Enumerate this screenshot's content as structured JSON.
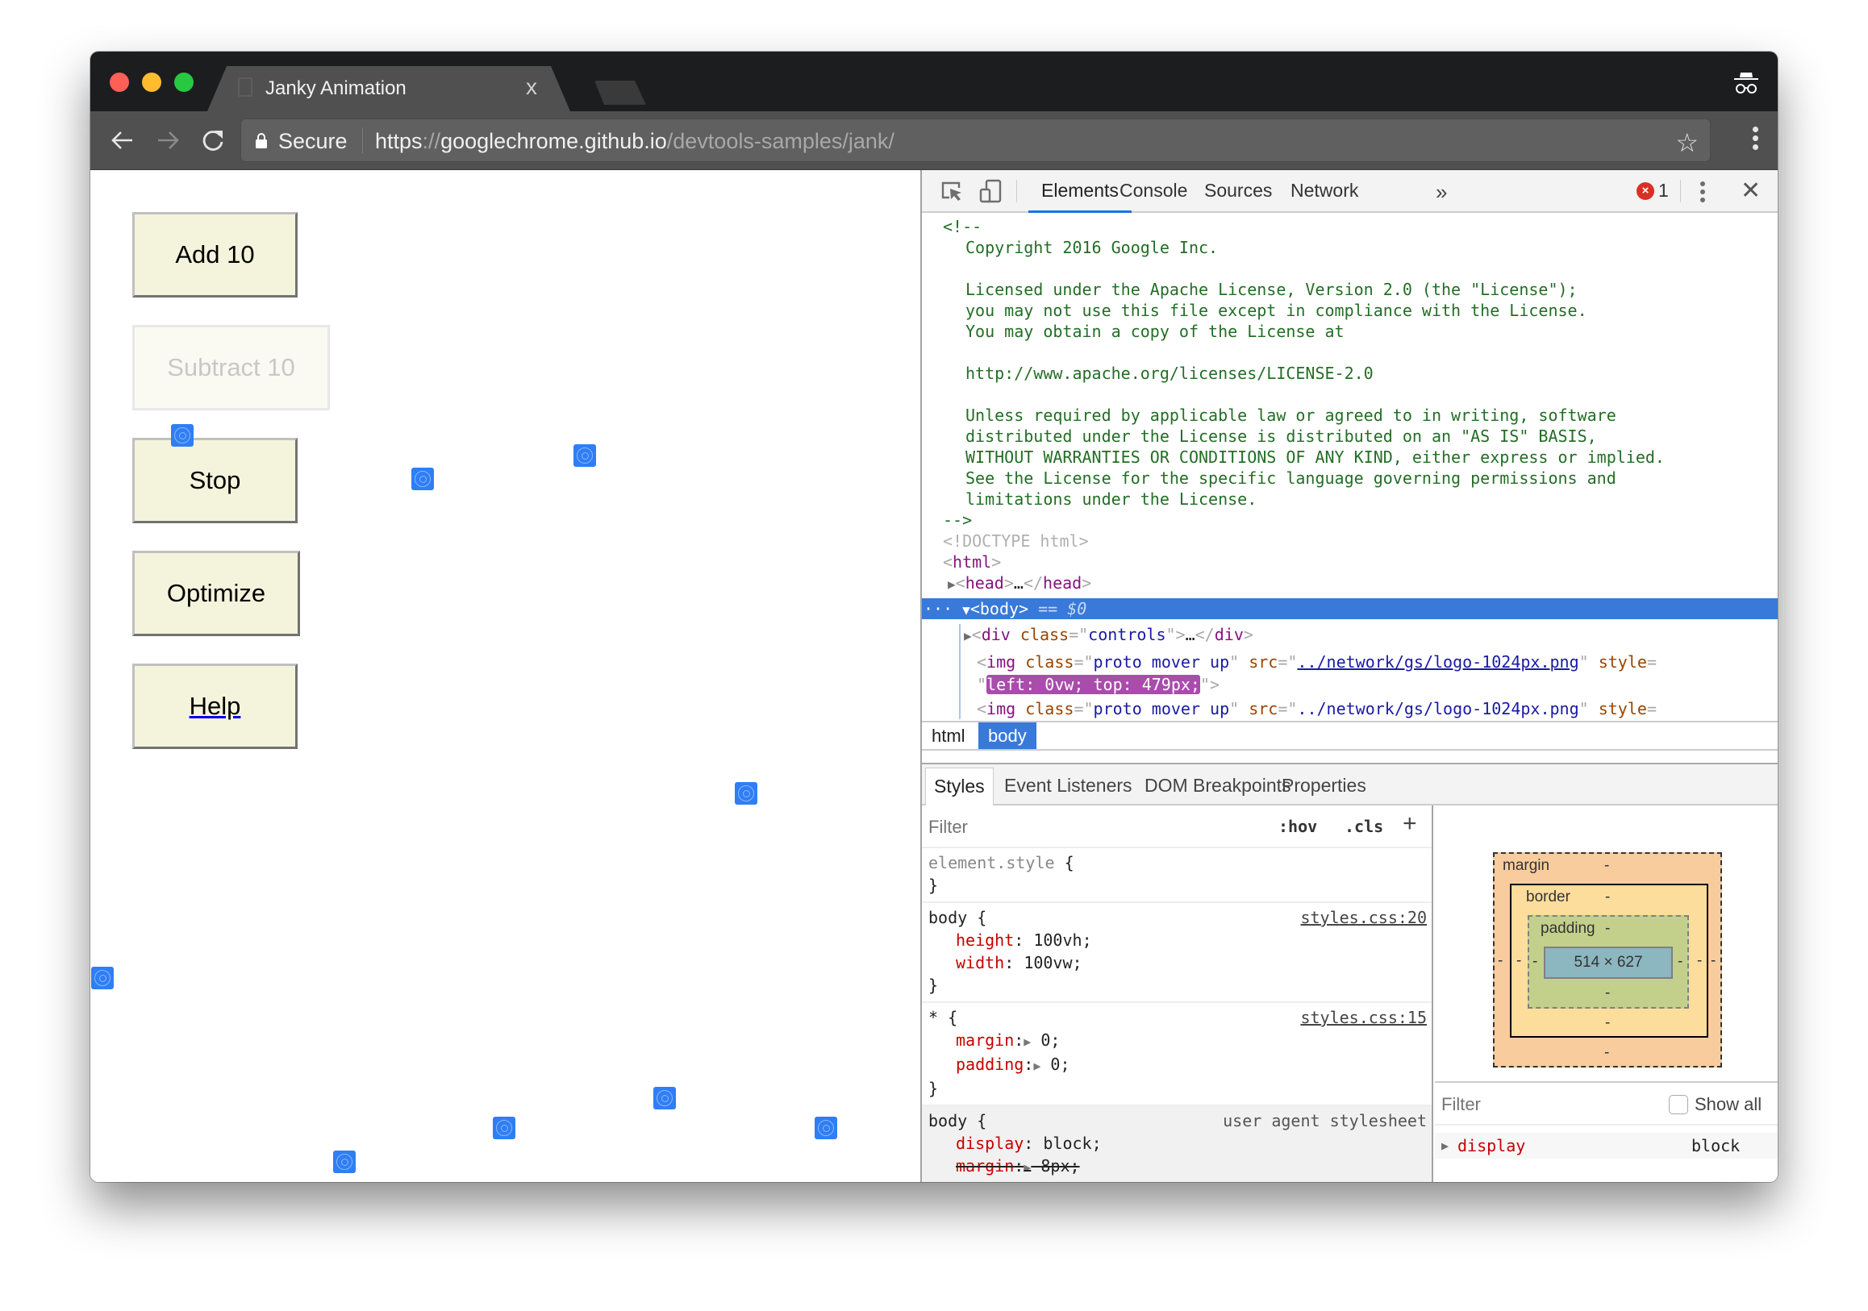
{
  "browser": {
    "tab_title": "Janky Animation",
    "tab_close": "x",
    "secure_label": "Secure",
    "url": {
      "scheme": "https",
      "scheme_sep": "://",
      "host": "googlechrome.github.io",
      "path": "/devtools-samples/jank/"
    },
    "icons": {
      "back": "arrow-left-icon",
      "forward": "arrow-right-icon",
      "reload": "reload-icon",
      "lock": "lock-icon",
      "bookmark": "star-icon",
      "menu": "kebab-menu-icon",
      "incognito": "incognito-icon"
    }
  },
  "page": {
    "buttons": [
      {
        "label": "Add 10",
        "state": "enabled"
      },
      {
        "label": "Subtract 10",
        "state": "disabled"
      },
      {
        "label": "Stop",
        "state": "enabled"
      },
      {
        "label": "Optimize",
        "state": "enabled"
      },
      {
        "label": "Help",
        "state": "link"
      }
    ],
    "mover_count": 9,
    "mover_icon": "chrome-logo-icon"
  },
  "devtools": {
    "tabs": [
      "Elements",
      "Console",
      "Sources",
      "Network"
    ],
    "active_tab": "Elements",
    "more_tabs": "»",
    "error_count": "1",
    "close": "✕",
    "dom": {
      "comment_open": "<!--",
      "comment_lines": [
        "Copyright 2016 Google Inc.",
        "",
        "Licensed under the Apache License, Version 2.0 (the \"License\");",
        "you may not use this file except in compliance with the License.",
        "You may obtain a copy of the License at",
        "",
        "http://www.apache.org/licenses/LICENSE-2.0",
        "",
        "Unless required by applicable law or agreed to in writing, software",
        "distributed under the License is distributed on an \"AS IS\" BASIS,",
        "WITHOUT WARRANTIES OR CONDITIONS OF ANY KIND, either express or implied.",
        "See the License for the specific language governing permissions and",
        "limitations under the License."
      ],
      "comment_close": "-->",
      "doctype": "<!DOCTYPE html>",
      "html_tag": "html",
      "head_tag": "head",
      "ellipsis": "…",
      "body_tag": "body",
      "selected_marker": "== $0",
      "div_attr": "class",
      "div_val": "controls",
      "img_class": "proto mover up",
      "img_src": "../network/gs/logo-1024px.png",
      "img_style_attr": "style",
      "img_style_val": "left: 0vw; top: 479px;"
    },
    "breadcrumbs": [
      "html",
      "body"
    ],
    "active_breadcrumb": "body",
    "styles_tabs": [
      "Styles",
      "Event Listeners",
      "DOM Breakpoints",
      "Properties"
    ],
    "active_styles_tab": "Styles",
    "styles_filter_placeholder": "Filter",
    "hov": ":hov",
    "cls": ".cls",
    "add": "+",
    "rules": [
      {
        "selector": "element.style",
        "source": "",
        "props": []
      },
      {
        "selector": "body",
        "source": "styles.css:20",
        "props": [
          {
            "name": "height",
            "value": "100vh",
            "expandable": false,
            "overridden": false
          },
          {
            "name": "width",
            "value": "100vw",
            "expandable": false,
            "overridden": false
          }
        ]
      },
      {
        "selector": "*",
        "source": "styles.css:15",
        "props": [
          {
            "name": "margin",
            "value": "0",
            "expandable": true,
            "overridden": false
          },
          {
            "name": "padding",
            "value": "0",
            "expandable": true,
            "overridden": false
          }
        ]
      },
      {
        "selector": "body",
        "source": "user agent stylesheet",
        "props": [
          {
            "name": "display",
            "value": "block",
            "expandable": false,
            "overridden": false
          },
          {
            "name": "margin",
            "value": "8px",
            "expandable": true,
            "overridden": true
          }
        ]
      }
    ],
    "box_model": {
      "margin_label": "margin",
      "border_label": "border",
      "padding_label": "padding",
      "empty": "-",
      "content_size": "514 × 627"
    },
    "computed": {
      "filter_placeholder": "Filter",
      "show_all_label": "Show all",
      "show_all_checked": false,
      "rows": [
        {
          "name": "display",
          "value": "block"
        }
      ]
    }
  }
}
